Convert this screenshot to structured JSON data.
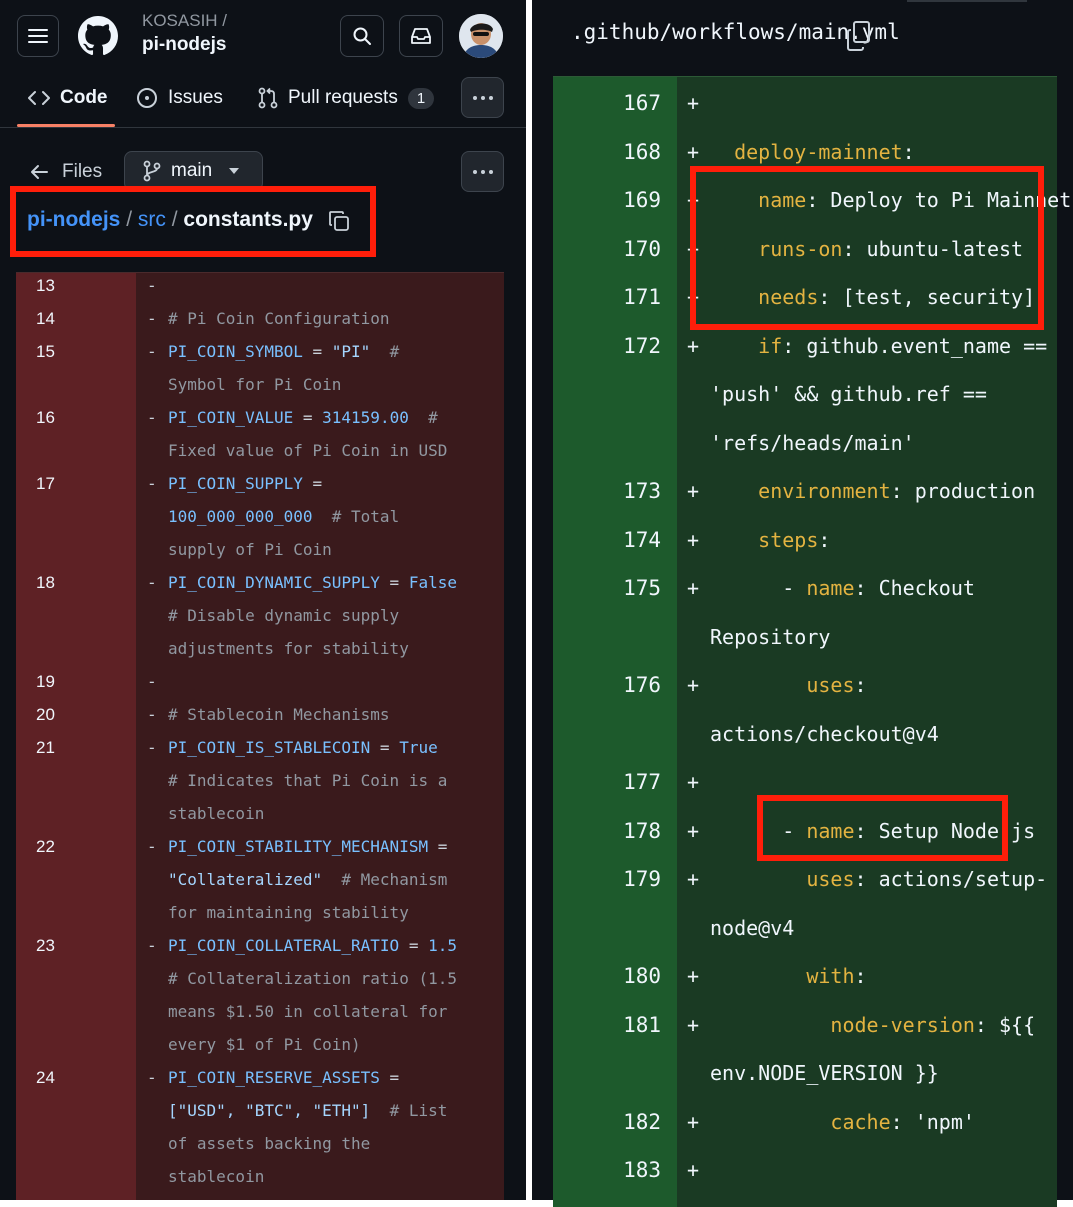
{
  "left_panel": {
    "repo_owner": "KOSASIH /",
    "repo_name": "pi-nodejs",
    "tabs": [
      {
        "label": "Code"
      },
      {
        "label": "Issues"
      },
      {
        "label": "Pull requests",
        "count": "1"
      }
    ],
    "files_label": "Files",
    "branch": "main",
    "breadcrumb": {
      "repo": "pi-nodejs",
      "sep": "/",
      "dir": "src",
      "file": "constants.py"
    },
    "diff_lines": [
      {
        "num": "13",
        "marker": "-",
        "lines": [
          []
        ]
      },
      {
        "num": "14",
        "marker": "-",
        "lines": [
          [
            [
              "# Pi Coin Configuration",
              "c"
            ]
          ]
        ]
      },
      {
        "num": "15",
        "marker": "-",
        "lines": [
          [
            [
              "PI_COIN_SYMBOL",
              "k"
            ],
            [
              " = ",
              "p"
            ],
            [
              "\"PI\"",
              "s"
            ],
            [
              "  #",
              "c"
            ]
          ],
          [
            [
              "Symbol for Pi Coin",
              "c"
            ]
          ]
        ]
      },
      {
        "num": "16",
        "marker": "-",
        "lines": [
          [
            [
              "PI_COIN_VALUE",
              "k"
            ],
            [
              " = ",
              "p"
            ],
            [
              "314159.00",
              "k"
            ],
            [
              "  #",
              "c"
            ]
          ],
          [
            [
              "Fixed value of Pi Coin in USD",
              "c"
            ]
          ]
        ]
      },
      {
        "num": "17",
        "marker": "-",
        "lines": [
          [
            [
              "PI_COIN_SUPPLY",
              "k"
            ],
            [
              " =",
              "p"
            ]
          ],
          [
            [
              "100_000_000_000",
              "k"
            ],
            [
              "  # Total",
              "c"
            ]
          ],
          [
            [
              "supply of Pi Coin",
              "c"
            ]
          ]
        ]
      },
      {
        "num": "18",
        "marker": "-",
        "lines": [
          [
            [
              "PI_COIN_DYNAMIC_SUPPLY",
              "k"
            ],
            [
              " = ",
              "p"
            ],
            [
              "False",
              "k"
            ]
          ],
          [
            [
              "# Disable dynamic supply",
              "c"
            ]
          ],
          [
            [
              "adjustments for stability",
              "c"
            ]
          ]
        ]
      },
      {
        "num": "19",
        "marker": "-",
        "lines": [
          []
        ]
      },
      {
        "num": "20",
        "marker": "-",
        "lines": [
          [
            [
              "# Stablecoin Mechanisms",
              "c"
            ]
          ]
        ]
      },
      {
        "num": "21",
        "marker": "-",
        "lines": [
          [
            [
              "PI_COIN_IS_STABLECOIN",
              "k"
            ],
            [
              " = ",
              "p"
            ],
            [
              "True",
              "k"
            ]
          ],
          [
            [
              "# Indicates that Pi Coin is a",
              "c"
            ]
          ],
          [
            [
              "stablecoin",
              "c"
            ]
          ]
        ]
      },
      {
        "num": "22",
        "marker": "-",
        "lines": [
          [
            [
              "PI_COIN_STABILITY_MECHANISM",
              "k"
            ],
            [
              " =",
              "p"
            ]
          ],
          [
            [
              "\"Collateralized\"",
              "s"
            ],
            [
              "  # Mechanism",
              "c"
            ]
          ],
          [
            [
              "for maintaining stability",
              "c"
            ]
          ]
        ]
      },
      {
        "num": "23",
        "marker": "-",
        "lines": [
          [
            [
              "PI_COIN_COLLATERAL_RATIO",
              "k"
            ],
            [
              " = ",
              "p"
            ],
            [
              "1.5",
              "k"
            ]
          ],
          [
            [
              "# Collateralization ratio (1.5",
              "c"
            ]
          ],
          [
            [
              "means $1.50 in collateral for",
              "c"
            ]
          ],
          [
            [
              "every $1 of Pi Coin)",
              "c"
            ]
          ]
        ]
      },
      {
        "num": "24",
        "marker": "-",
        "lines": [
          [
            [
              "PI_COIN_RESERVE_ASSETS",
              "k"
            ],
            [
              " =",
              "p"
            ]
          ],
          [
            [
              "[\"USD\", \"BTC\", \"ETH\"]",
              "s"
            ],
            [
              "  # List",
              "c"
            ]
          ],
          [
            [
              "of assets backing the",
              "c"
            ]
          ],
          [
            [
              "stablecoin",
              "c"
            ]
          ]
        ]
      }
    ]
  },
  "right_panel": {
    "file_path": ".github/workflows/main.yml",
    "diff_lines": [
      {
        "num": "167",
        "marker": "+",
        "lines": [
          []
        ]
      },
      {
        "num": "168",
        "marker": "+",
        "lines": [
          [
            [
              "  ",
              "w"
            ],
            [
              "deploy-mainnet",
              "y"
            ],
            [
              ":",
              "w"
            ]
          ]
        ]
      },
      {
        "num": "169",
        "marker": "+",
        "lines": [
          [
            [
              "    ",
              "w"
            ],
            [
              "name",
              "y"
            ],
            [
              ": Deploy to Pi Mainnet",
              "w"
            ]
          ]
        ]
      },
      {
        "num": "170",
        "marker": "+",
        "lines": [
          [
            [
              "    ",
              "w"
            ],
            [
              "runs-on",
              "y"
            ],
            [
              ": ubuntu-latest",
              "w"
            ]
          ]
        ]
      },
      {
        "num": "171",
        "marker": "+",
        "lines": [
          [
            [
              "    ",
              "w"
            ],
            [
              "needs",
              "y"
            ],
            [
              ": [test, security]",
              "w"
            ]
          ]
        ]
      },
      {
        "num": "172",
        "marker": "+",
        "lines": [
          [
            [
              "    ",
              "w"
            ],
            [
              "if",
              "y"
            ],
            [
              ": github.event_name ==",
              "w"
            ]
          ],
          [
            [
              "'push' && github.ref ==",
              "w"
            ]
          ],
          [
            [
              "'refs/heads/main'",
              "w"
            ]
          ]
        ]
      },
      {
        "num": "173",
        "marker": "+",
        "lines": [
          [
            [
              "    ",
              "w"
            ],
            [
              "environment",
              "y"
            ],
            [
              ": production",
              "w"
            ]
          ]
        ]
      },
      {
        "num": "174",
        "marker": "+",
        "lines": [
          [
            [
              "    ",
              "w"
            ],
            [
              "steps",
              "y"
            ],
            [
              ":",
              "w"
            ]
          ]
        ]
      },
      {
        "num": "175",
        "marker": "+",
        "lines": [
          [
            [
              "      - ",
              "w"
            ],
            [
              "name",
              "y"
            ],
            [
              ": Checkout",
              "w"
            ]
          ],
          [
            [
              "Repository",
              "w"
            ]
          ]
        ]
      },
      {
        "num": "176",
        "marker": "+",
        "lines": [
          [
            [
              "        ",
              "w"
            ],
            [
              "uses",
              "y"
            ],
            [
              ":",
              "w"
            ]
          ],
          [
            [
              "actions/checkout@v4",
              "w"
            ]
          ]
        ]
      },
      {
        "num": "177",
        "marker": "+",
        "lines": [
          []
        ]
      },
      {
        "num": "178",
        "marker": "+",
        "lines": [
          [
            [
              "      - ",
              "w"
            ],
            [
              "name",
              "y"
            ],
            [
              ": Setup Node.js",
              "w"
            ]
          ]
        ]
      },
      {
        "num": "179",
        "marker": "+",
        "lines": [
          [
            [
              "        ",
              "w"
            ],
            [
              "uses",
              "y"
            ],
            [
              ": actions/setup-",
              "w"
            ]
          ],
          [
            [
              "node@v4",
              "w"
            ]
          ]
        ]
      },
      {
        "num": "180",
        "marker": "+",
        "lines": [
          [
            [
              "        ",
              "w"
            ],
            [
              "with",
              "y"
            ],
            [
              ":",
              "w"
            ]
          ]
        ]
      },
      {
        "num": "181",
        "marker": "+",
        "lines": [
          [
            [
              "          ",
              "w"
            ],
            [
              "node-version",
              "y"
            ],
            [
              ": ${{",
              "w"
            ]
          ],
          [
            [
              "env.NODE_VERSION }}",
              "w"
            ]
          ]
        ]
      },
      {
        "num": "182",
        "marker": "+",
        "lines": [
          [
            [
              "          ",
              "w"
            ],
            [
              "cache",
              "y"
            ],
            [
              ": 'npm'",
              "w"
            ]
          ]
        ]
      },
      {
        "num": "183",
        "marker": "+",
        "lines": [
          []
        ]
      }
    ]
  },
  "colors": {
    "highlight_box": "#ff1e0a",
    "deleted_bg": "#3a1a1c",
    "added_bg": "#1a3a23",
    "tab_underline": "#f78166"
  }
}
